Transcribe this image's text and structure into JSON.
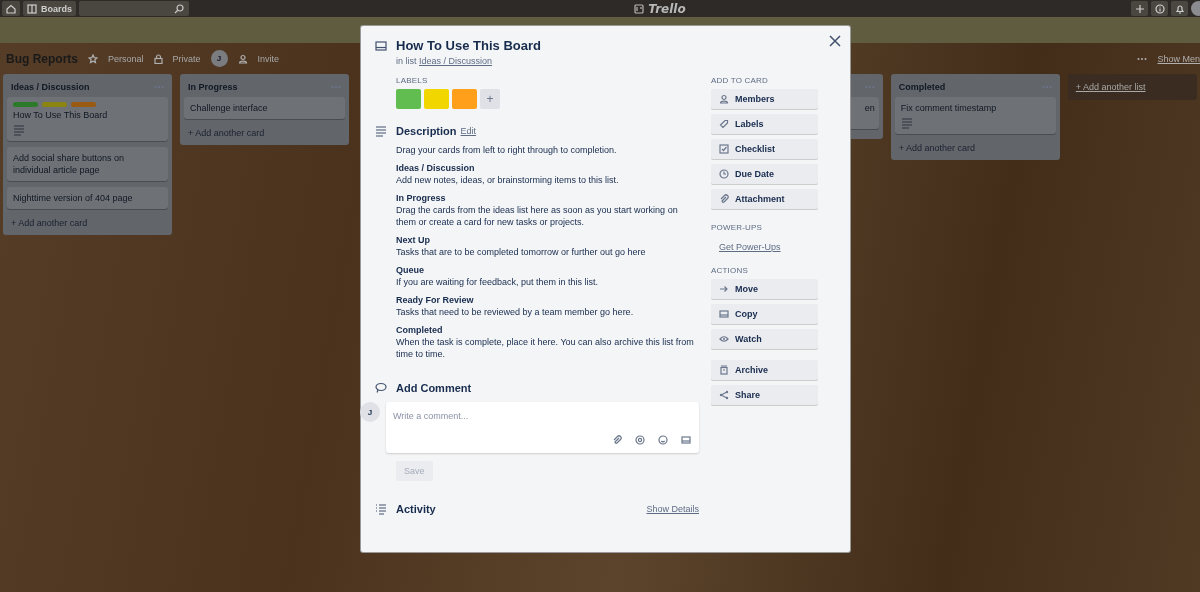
{
  "top_bar": {
    "boards_label": "Boards",
    "logo": "Trello"
  },
  "board_header": {
    "title": "Bug Reports",
    "team": "Personal",
    "visibility": "Private",
    "member_initial": "J",
    "invite": "Invite",
    "show_menu": "Show Men"
  },
  "lists": [
    {
      "kind": "full",
      "title": "Ideas / Discussion",
      "cards": [
        {
          "title": "How To Use This Board",
          "labels": [
            {
              "color": "#2a7a2a"
            },
            {
              "color": "#8c8410"
            },
            {
              "color": "#9a5a12"
            }
          ],
          "has_description": true
        },
        {
          "title": "Add social share buttons on individual article page",
          "has_description": false
        },
        {
          "title": "Nighttime version of 404 page",
          "has_description": false
        }
      ],
      "add_card": "+ Add another card"
    },
    {
      "kind": "full",
      "title": "In Progress",
      "cards": [
        {
          "title": "Challenge interface",
          "has_description": false
        }
      ],
      "add_card": "+ Add another card"
    },
    {
      "kind": "partial",
      "cards": [
        {
          "title": "en",
          "has_description": false
        }
      ]
    },
    {
      "kind": "full",
      "title": "Completed",
      "cards": [
        {
          "title": "Fix comment timestamp",
          "has_description": true
        }
      ],
      "add_card": "+ Add another card"
    }
  ],
  "add_list": "+ Add another list",
  "card_modal": {
    "title": "How To Use This Board",
    "list_prefix": "in list",
    "list_name": "Ideas / Discussion",
    "labels_heading": "LABELS",
    "labels": [
      {
        "color": "#61bd4f"
      },
      {
        "color": "#f2d600"
      },
      {
        "color": "#ff9f1a"
      }
    ],
    "add_label": "+",
    "description": {
      "heading": "Description",
      "edit": "Edit",
      "intro": "Drag your cards from left to right through to completion.",
      "sections": [
        {
          "heading": "Ideas / Discussion",
          "text": "Add new notes, ideas, or brainstorming items to this list."
        },
        {
          "heading": "In Progress",
          "text": "Drag the cards from the ideas list here as soon as you start working on them or create a card for new tasks or projects."
        },
        {
          "heading": "Next Up",
          "text": "Tasks that are to be completed tomorrow or further out go here"
        },
        {
          "heading": "Queue",
          "text": "If you are waiting for feedback, put them in this list."
        },
        {
          "heading": "Ready For Review",
          "text": "Tasks that need to be reviewed by a team member go here."
        },
        {
          "heading": "Completed",
          "text": "When the task is complete, place it here. You can also archive this list from time to time."
        }
      ]
    },
    "comment": {
      "heading": "Add Comment",
      "avatar": "J",
      "placeholder": "Write a comment...",
      "save": {
        "label": "Save",
        "disabled": true
      }
    },
    "activity": {
      "heading": "Activity",
      "show_details": "Show Details"
    },
    "sidebar": [
      {
        "kind": "buttons",
        "heading": "ADD TO CARD",
        "groups": [
          [
            "Members",
            "Labels",
            "Checklist",
            "Due Date",
            "Attachment"
          ]
        ]
      },
      {
        "kind": "links",
        "heading": "POWER-UPS",
        "links": [
          "Get Power-Ups"
        ]
      },
      {
        "kind": "buttons",
        "heading": "ACTIONS",
        "groups": [
          [
            "Move",
            "Copy",
            "Watch"
          ],
          [
            "Archive",
            "Share"
          ]
        ]
      }
    ]
  }
}
